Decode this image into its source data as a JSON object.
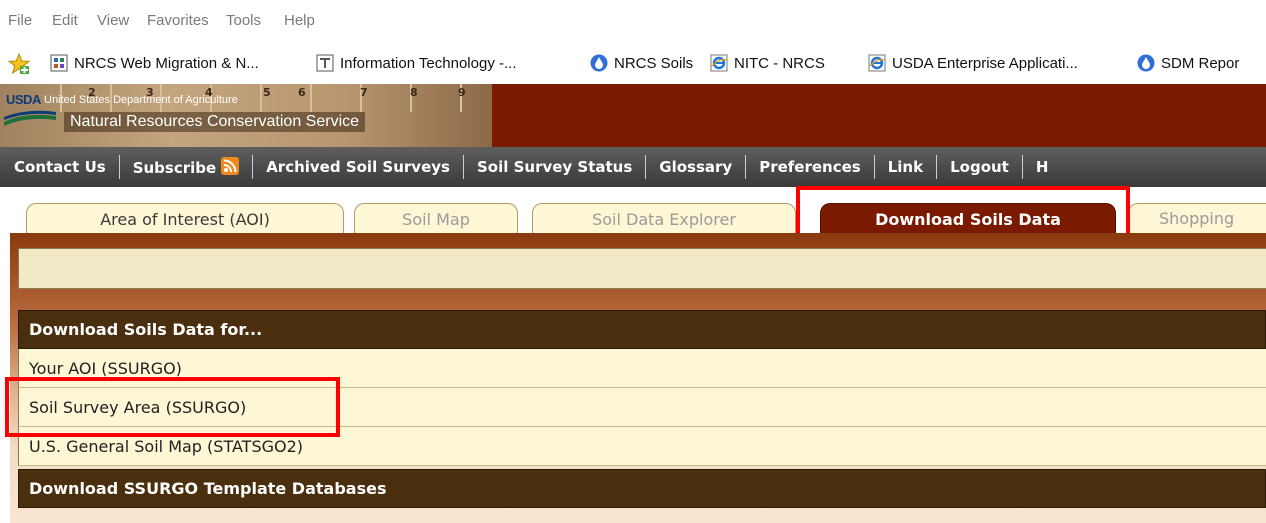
{
  "browser": {
    "menu": [
      "File",
      "Edit",
      "View",
      "Favorites",
      "Tools",
      "Help"
    ],
    "favorites": [
      {
        "label": "NRCS Web Migration & N...",
        "icon": "grid-doc-icon"
      },
      {
        "label": "Information Technology -...",
        "icon": "page-doc-icon"
      },
      {
        "label": "NRCS Soils",
        "icon": "water-drop-icon"
      },
      {
        "label": "NITC - NRCS",
        "icon": "ie-page-icon"
      },
      {
        "label": "USDA Enterprise Applicati...",
        "icon": "ie-page-icon"
      },
      {
        "label": "SDM Repor",
        "icon": "water-drop-icon"
      }
    ]
  },
  "banner": {
    "logo_text": "USDA",
    "department": "United States Department of Agriculture",
    "agency": "Natural Resources Conservation Service",
    "ruler_numbers": [
      "2",
      "3",
      "4",
      "5",
      "6",
      "7",
      "8",
      "9"
    ],
    "photo_color": "#b89670",
    "brand_color": "#7a1a00"
  },
  "nav": {
    "items": [
      "Contact Us",
      "Subscribe",
      "Archived Soil Surveys",
      "Soil Survey Status",
      "Glossary",
      "Preferences",
      "Link",
      "Logout",
      "H"
    ]
  },
  "tabs": [
    {
      "label": "Area of Interest (AOI)",
      "state": "normal"
    },
    {
      "label": "Soil Map",
      "state": "disabled"
    },
    {
      "label": "Soil Data Explorer",
      "state": "disabled"
    },
    {
      "label": "Download Soils Data",
      "state": "active"
    },
    {
      "label": "Shopping",
      "state": "disabled"
    }
  ],
  "download_panel": {
    "header": "Download Soils Data for...",
    "rows": [
      "Your AOI (SSURGO)",
      "Soil Survey Area (SSURGO)",
      "U.S. General Soil Map (STATSGO2)"
    ]
  },
  "template_panel": {
    "header": "Download SSURGO Template Databases"
  },
  "annotation_color": "#ff0000"
}
